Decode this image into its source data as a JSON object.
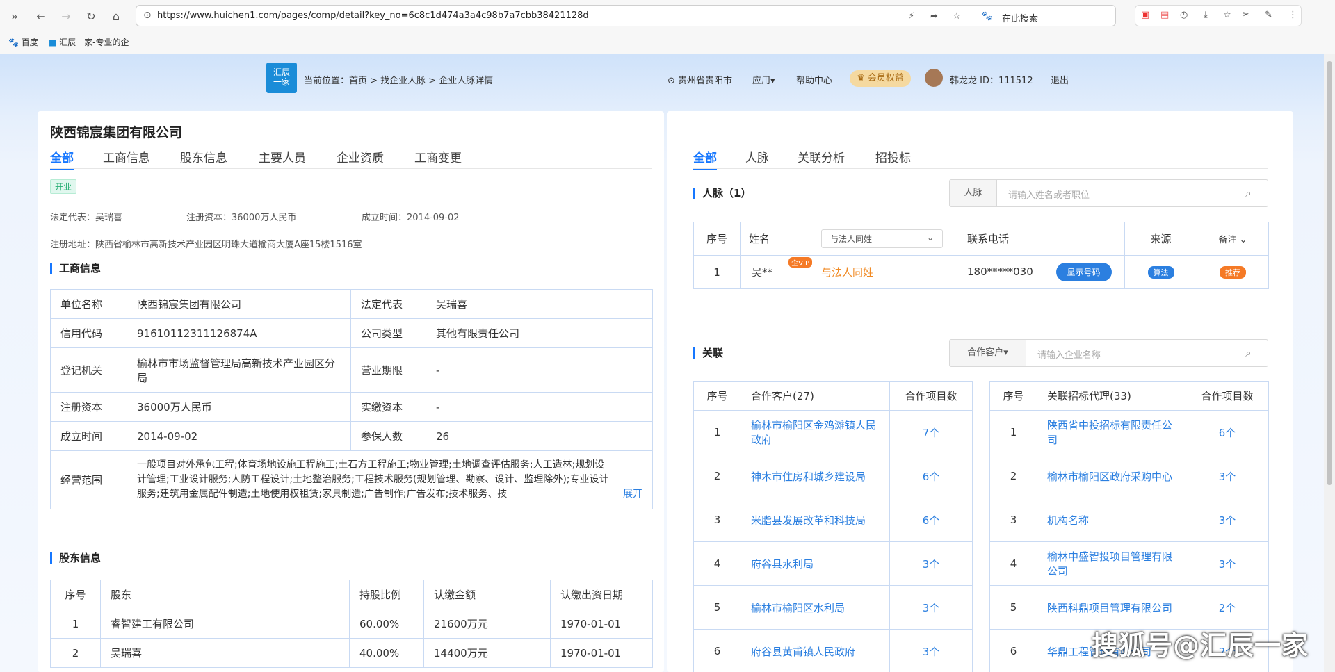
{
  "browser": {
    "url": "https://www.huichen1.com/pages/comp/detail?key_no=6c8c1d474a3a4c98b7a7cbb38421128d",
    "search_placeholder": "在此搜索",
    "bookmarks": [
      "百度",
      "汇辰一家-专业的企"
    ]
  },
  "header": {
    "logo_text": "汇辰\n一家",
    "breadcrumb": "当前位置：首页 > 找企业人脉 > 企业人脉详情",
    "location": "贵州省贵阳市",
    "apps": "应用",
    "help": "帮助中心",
    "vip": "会员权益",
    "user": "韩龙龙 ID：111512",
    "logout": "退出"
  },
  "company": {
    "name": "陕西锦宸集团有限公司",
    "status": "开业",
    "legal_rep": "法定代表：吴瑞喜",
    "capital": "注册资本：36000万人民币",
    "founded": "成立时间：2014-09-02",
    "address": "注册地址：陕西省榆林市高新技术产业园区明珠大道榆商大厦A座15楼1516室"
  },
  "left_tabs": [
    "全部",
    "工商信息",
    "股东信息",
    "主要人员",
    "企业资质",
    "工商变更"
  ],
  "biz": {
    "title": "工商信息",
    "rows": [
      [
        "单位名称",
        "陕西锦宸集团有限公司",
        "法定代表",
        "吴瑞喜"
      ],
      [
        "信用代码",
        "91610112311126874A",
        "公司类型",
        "其他有限责任公司"
      ],
      [
        "登记机关",
        "榆林市市场监督管理局高新技术产业园区分局",
        "营业期限",
        "-"
      ],
      [
        "注册资本",
        "36000万人民币",
        "实缴资本",
        "-"
      ],
      [
        "成立时间",
        "2014-09-02",
        "参保人数",
        "26"
      ]
    ],
    "scope_label": "经营范围",
    "scope": "一般项目对外承包工程;体育场地设施工程施工;土石方工程施工;物业管理;土地调查评估服务;人工造林;规划设计管理;工业设计服务;人防工程设计;土地整治服务;工程技术服务(规划管理、勘察、设计、监理除外);专业设计服务;建筑用金属配件制造;土地使用权租赁;家具制造;广告制作;广告发布;技术服务、技",
    "expand": "展开"
  },
  "shareholders": {
    "title": "股东信息",
    "headers": [
      "序号",
      "股东",
      "持股比例",
      "认缴金额",
      "认缴出资日期"
    ],
    "rows": [
      [
        "1",
        "睿智建工有限公司",
        "60.00%",
        "21600万元",
        "1970-01-01"
      ],
      [
        "2",
        "吴瑞喜",
        "40.00%",
        "14400万元",
        "1970-01-01"
      ]
    ]
  },
  "right_tabs": [
    "全部",
    "人脉",
    "关联分析",
    "招投标"
  ],
  "contacts": {
    "title": "人脉（1）",
    "search_label": "人脉",
    "search_placeholder": "请输入姓名或者职位",
    "headers": [
      "序号",
      "姓名",
      "与法人同姓",
      "联系电话",
      "来源",
      "备注"
    ],
    "row": {
      "no": "1",
      "name": "吴**",
      "vip": "企VIP",
      "relation": "与法人同姓",
      "phone": "180*****030",
      "show_btn": "显示号码",
      "source": "算法",
      "remark": "推荐"
    }
  },
  "related": {
    "title": "关联",
    "search_label": "合作客户",
    "search_placeholder": "请输入企业名称",
    "clients": {
      "headers": [
        "序号",
        "合作客户(27)",
        "合作项目数"
      ],
      "rows": [
        [
          "1",
          "榆林市榆阳区金鸡滩镇人民政府",
          "7个"
        ],
        [
          "2",
          "神木市住房和城乡建设局",
          "6个"
        ],
        [
          "3",
          "米脂县发展改革和科技局",
          "6个"
        ],
        [
          "4",
          "府谷县水利局",
          "3个"
        ],
        [
          "5",
          "榆林市榆阳区水利局",
          "3个"
        ],
        [
          "6",
          "府谷县黄甫镇人民政府",
          "3个"
        ]
      ]
    },
    "agents": {
      "headers": [
        "序号",
        "关联招标代理(33)",
        "合作项目数"
      ],
      "rows": [
        [
          "1",
          "陕西省中投招标有限责任公司",
          "6个"
        ],
        [
          "2",
          "榆林市榆阳区政府采购中心",
          "3个"
        ],
        [
          "3",
          "机构名称",
          "3个"
        ],
        [
          "4",
          "榆林中盛智投项目管理有限公司",
          "3个"
        ],
        [
          "5",
          "陕西科鼎项目管理有限公司",
          "2个"
        ],
        [
          "6",
          "华鼎工程管理有限公司",
          "2个"
        ]
      ]
    }
  },
  "watermark": "搜狐号@汇辰一家"
}
